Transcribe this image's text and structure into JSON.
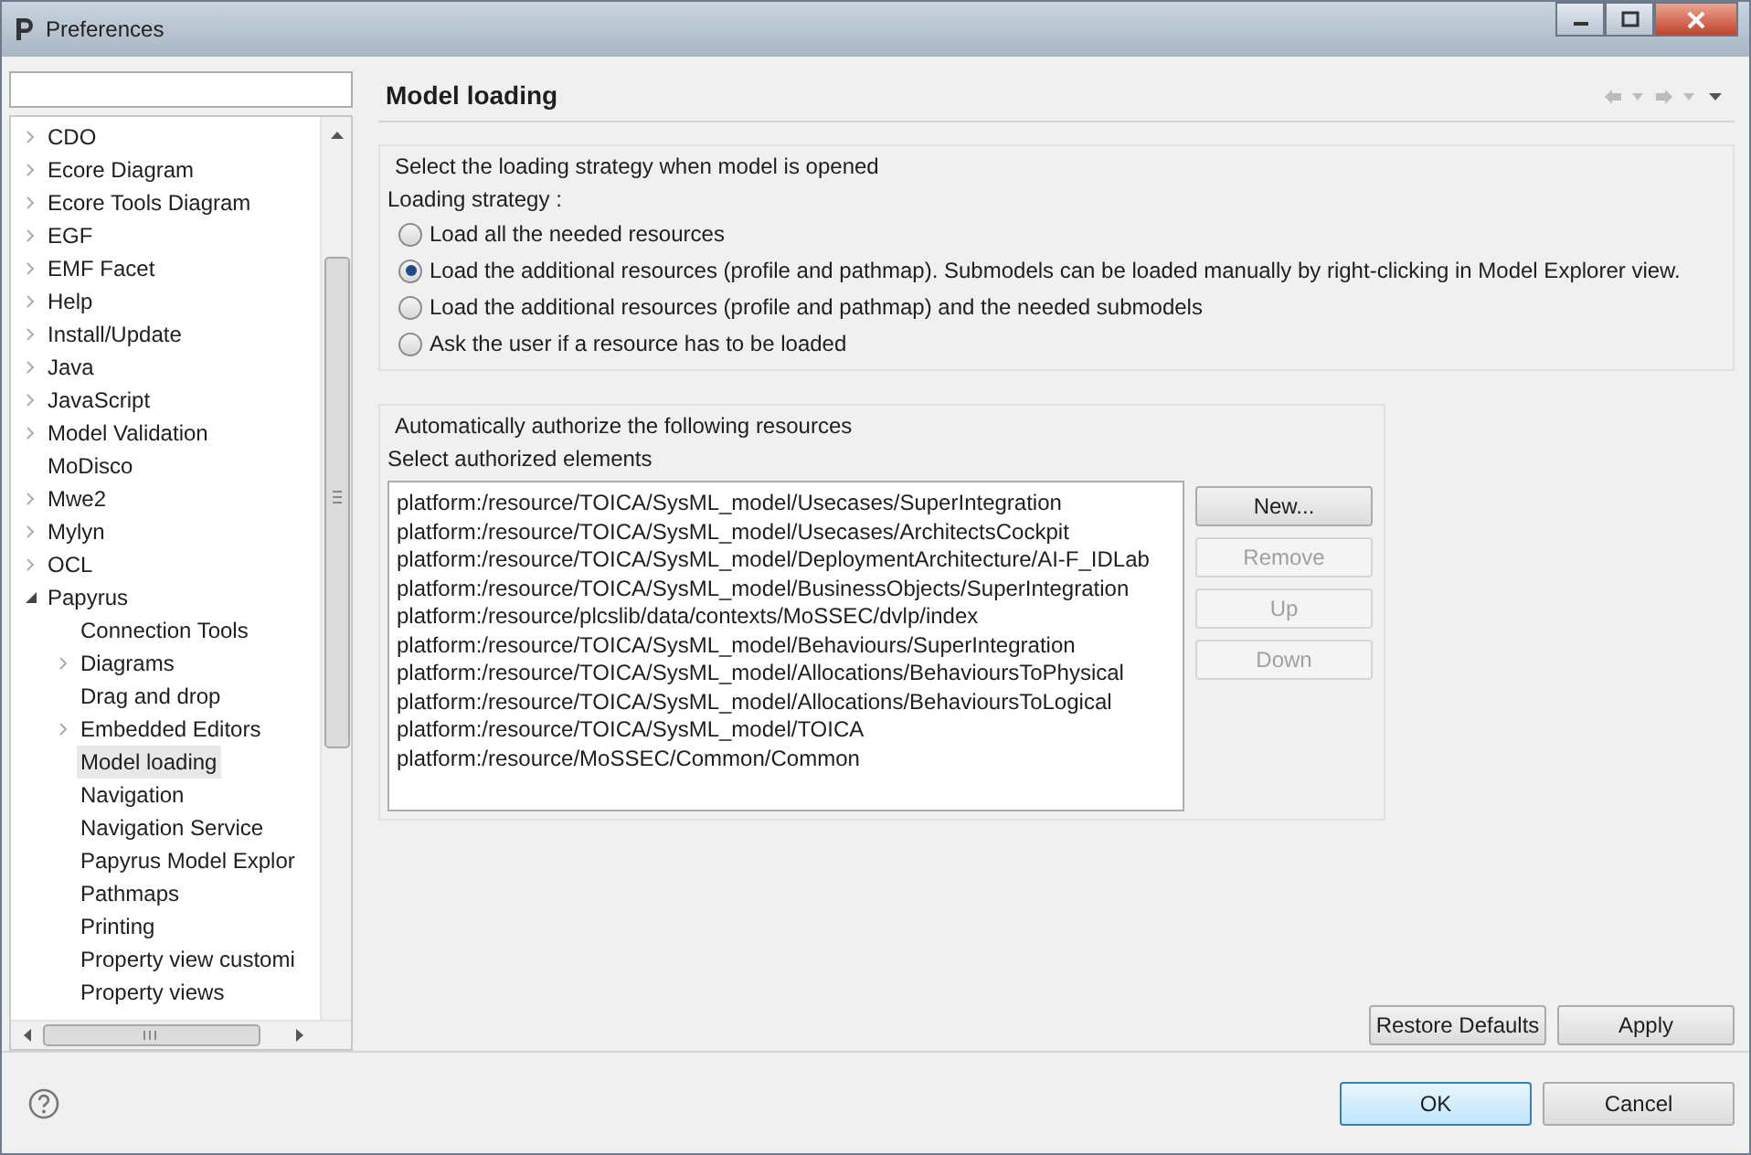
{
  "window": {
    "title": "Preferences"
  },
  "tree": [
    {
      "label": "CDO",
      "kind": "collapsed",
      "selected": false
    },
    {
      "label": "Ecore Diagram",
      "kind": "collapsed",
      "selected": false
    },
    {
      "label": "Ecore Tools Diagram",
      "kind": "collapsed",
      "selected": false
    },
    {
      "label": "EGF",
      "kind": "collapsed",
      "selected": false
    },
    {
      "label": "EMF Facet",
      "kind": "collapsed",
      "selected": false
    },
    {
      "label": "Help",
      "kind": "collapsed",
      "selected": false
    },
    {
      "label": "Install/Update",
      "kind": "collapsed",
      "selected": false
    },
    {
      "label": "Java",
      "kind": "collapsed",
      "selected": false
    },
    {
      "label": "JavaScript",
      "kind": "collapsed",
      "selected": false
    },
    {
      "label": "Model Validation",
      "kind": "collapsed",
      "selected": false
    },
    {
      "label": "MoDisco",
      "kind": "leaf",
      "selected": false
    },
    {
      "label": "Mwe2",
      "kind": "collapsed",
      "selected": false
    },
    {
      "label": "Mylyn",
      "kind": "collapsed",
      "selected": false
    },
    {
      "label": "OCL",
      "kind": "collapsed",
      "selected": false
    },
    {
      "label": "Papyrus",
      "kind": "expanded",
      "selected": false,
      "children": [
        {
          "label": "Connection Tools",
          "kind": "leaf",
          "selected": false
        },
        {
          "label": "Diagrams",
          "kind": "collapsed",
          "selected": false
        },
        {
          "label": "Drag and drop",
          "kind": "leaf",
          "selected": false
        },
        {
          "label": "Embedded Editors",
          "kind": "collapsed",
          "selected": false
        },
        {
          "label": "Model loading",
          "kind": "leaf",
          "selected": true
        },
        {
          "label": "Navigation",
          "kind": "leaf",
          "selected": false
        },
        {
          "label": "Navigation Service",
          "kind": "leaf",
          "selected": false
        },
        {
          "label": "Papyrus Model Explor",
          "kind": "leaf",
          "selected": false
        },
        {
          "label": "Pathmaps",
          "kind": "leaf",
          "selected": false
        },
        {
          "label": "Printing",
          "kind": "leaf",
          "selected": false
        },
        {
          "label": "Property view customi",
          "kind": "leaf",
          "selected": false
        },
        {
          "label": "Property views",
          "kind": "leaf",
          "selected": false
        }
      ]
    }
  ],
  "page": {
    "title": "Model loading",
    "strategy_group": {
      "title": "Select the loading strategy when model is opened",
      "label": "Loading strategy :",
      "options": [
        {
          "label": "Load all the needed resources",
          "selected": false
        },
        {
          "label": "Load the additional resources (profile and pathmap). Submodels can be loaded manually by right-clicking in Model Explorer view.",
          "selected": true
        },
        {
          "label": "Load the additional resources (profile and pathmap) and the needed submodels",
          "selected": false
        },
        {
          "label": "Ask the user if a resource has to be loaded",
          "selected": false
        }
      ]
    },
    "authorize_group": {
      "title": "Automatically authorize the following resources",
      "label": "Select authorized elements",
      "items": [
        "platform:/resource/TOICA/SysML_model/Usecases/SuperIntegration",
        "platform:/resource/TOICA/SysML_model/Usecases/ArchitectsCockpit",
        "platform:/resource/TOICA/SysML_model/DeploymentArchitecture/AI-F_IDLab",
        "platform:/resource/TOICA/SysML_model/BusinessObjects/SuperIntegration",
        "platform:/resource/plcslib/data/contexts/MoSSEC/dvlp/index",
        "platform:/resource/TOICA/SysML_model/Behaviours/SuperIntegration",
        "platform:/resource/TOICA/SysML_model/Allocations/BehavioursToPhysical",
        "platform:/resource/TOICA/SysML_model/Allocations/BehavioursToLogical",
        "platform:/resource/TOICA/SysML_model/TOICA",
        "platform:/resource/MoSSEC/Common/Common"
      ],
      "buttons": [
        {
          "label": "New...",
          "disabled": false
        },
        {
          "label": "Remove",
          "disabled": true
        },
        {
          "label": "Up",
          "disabled": true
        },
        {
          "label": "Down",
          "disabled": true
        }
      ]
    },
    "buttons": [
      "Restore Defaults",
      "Apply"
    ]
  },
  "footer": {
    "buttons": [
      {
        "label": "OK",
        "default": true
      },
      {
        "label": "Cancel",
        "default": false
      }
    ]
  }
}
